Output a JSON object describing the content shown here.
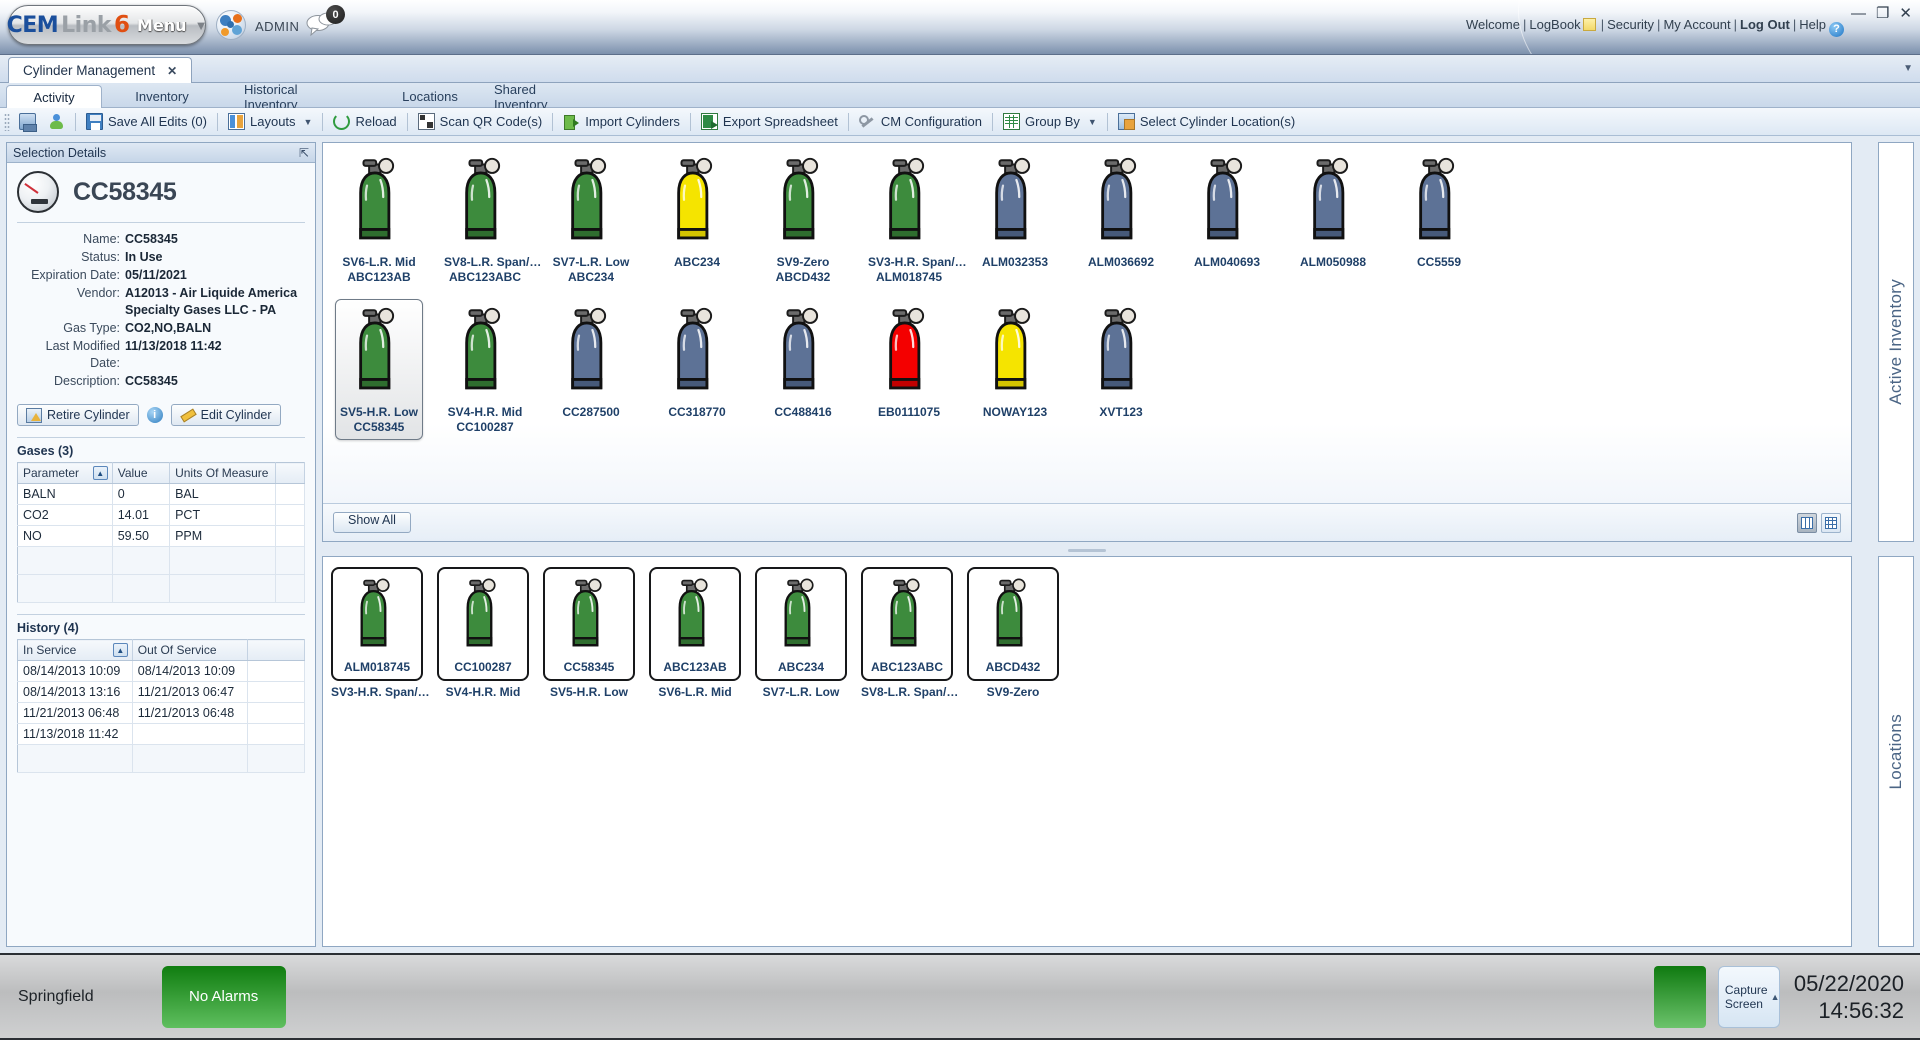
{
  "header": {
    "logo": {
      "cem": "CEM",
      "link": "Link",
      "six": "6",
      "menu": "Menu",
      "caret": "▼"
    },
    "globe_icon": "globe-icon",
    "user": "ADMIN",
    "chat_count": "0",
    "links": {
      "welcome": "Welcome",
      "logbook": "LogBook",
      "security": "Security",
      "my_account": "My Account",
      "log_out": "Log Out",
      "help": "Help",
      "help_glyph": "?",
      "sep": "|"
    },
    "window_controls": {
      "minimize": "—",
      "maximize": "❐",
      "close": "✕"
    }
  },
  "document_tab": {
    "title": "Cylinder Management",
    "close": "✕",
    "overflow_caret": "▼"
  },
  "subtabs": [
    {
      "label": "Activity",
      "active": true
    },
    {
      "label": "Inventory",
      "active": false
    },
    {
      "label": "Historical Inventory",
      "active": false
    },
    {
      "label": "Locations",
      "active": false
    },
    {
      "label": "Shared Inventory",
      "active": false
    }
  ],
  "toolbar": [
    {
      "label": "",
      "icon": "monitor-icon"
    },
    {
      "label": "",
      "icon": "user-icon"
    },
    {
      "label": "Save All Edits (0)",
      "icon": "save-icon"
    },
    {
      "label": "Layouts",
      "icon": "layouts-icon",
      "caret": "▼"
    },
    {
      "label": "Reload",
      "icon": "reload-icon"
    },
    {
      "label": "Scan QR Code(s)",
      "icon": "qr-icon"
    },
    {
      "label": "Import Cylinders",
      "icon": "import-icon"
    },
    {
      "label": "Export Spreadsheet",
      "icon": "export-icon"
    },
    {
      "label": "CM Configuration",
      "icon": "wrench-icon"
    },
    {
      "label": "Group By",
      "icon": "grid-icon",
      "caret": "▼"
    },
    {
      "label": "Select Cylinder Location(s)",
      "icon": "location-icon"
    }
  ],
  "selection_details": {
    "panel_title": "Selection Details",
    "pin_glyph": "⇱",
    "gauge_icon": "gauge-icon",
    "title": "CC58345",
    "fields": [
      {
        "key": "Name:",
        "value": "CC58345"
      },
      {
        "key": "Status:",
        "value": "In Use"
      },
      {
        "key": "Expiration Date:",
        "value": "05/11/2021"
      },
      {
        "key": "Vendor:",
        "value": "A12013 - Air Liquide America Specialty Gases LLC - PA"
      },
      {
        "key": "Gas Type:",
        "value": "CO2,NO,BALN"
      },
      {
        "key": "Last Modified Date:",
        "value": "11/13/2018 11:42"
      },
      {
        "key": "Description:",
        "value": "CC58345"
      }
    ],
    "retire_button": "Retire Cylinder",
    "info_glyph": "i",
    "edit_button": "Edit Cylinder",
    "gases": {
      "section_label": "Gases (3)",
      "columns": [
        "Parameter",
        "Value",
        "Units Of Measure",
        ""
      ],
      "sort_glyph": "▲",
      "rows": [
        [
          "BALN",
          "0",
          "BAL",
          ""
        ],
        [
          "CO2",
          "14.01",
          "PCT",
          ""
        ],
        [
          "NO",
          "59.50",
          "PPM",
          ""
        ]
      ]
    },
    "history": {
      "section_label": "History (4)",
      "columns": [
        "In Service",
        "Out Of Service",
        ""
      ],
      "sort_glyph": "▲",
      "rows": [
        [
          "08/14/2013 10:09",
          "08/14/2013 10:09",
          ""
        ],
        [
          "08/14/2013 13:16",
          "11/21/2013 06:47",
          ""
        ],
        [
          "11/21/2013 06:48",
          "11/21/2013 06:48",
          ""
        ],
        [
          "11/13/2018 11:42",
          "",
          ""
        ]
      ]
    }
  },
  "inventory_panel": {
    "show_all_button": "Show All",
    "view_toggles": [
      {
        "name": "column-view-toggle",
        "active": true
      },
      {
        "name": "grid-view-toggle",
        "active": false
      }
    ],
    "cylinders": [
      {
        "line1": "SV6-L.R. Mid",
        "line2": "ABC123AB",
        "color": "green",
        "selected": false
      },
      {
        "line1": "SV8-L.R. Span/…",
        "line2": "ABC123ABC",
        "color": "green",
        "selected": false
      },
      {
        "line1": "SV7-L.R. Low",
        "line2": "ABC234",
        "color": "green",
        "selected": false
      },
      {
        "line1": "ABC234",
        "line2": "",
        "color": "yellow",
        "selected": false
      },
      {
        "line1": "SV9-Zero",
        "line2": "ABCD432",
        "color": "green",
        "selected": false
      },
      {
        "line1": "SV3-H.R. Span/…",
        "line2": "ALM018745",
        "color": "green",
        "selected": false
      },
      {
        "line1": "ALM032353",
        "line2": "",
        "color": "blue",
        "selected": false
      },
      {
        "line1": "ALM036692",
        "line2": "",
        "color": "blue",
        "selected": false
      },
      {
        "line1": "ALM040693",
        "line2": "",
        "color": "blue",
        "selected": false
      },
      {
        "line1": "ALM050988",
        "line2": "",
        "color": "blue",
        "selected": false
      },
      {
        "line1": "CC5559",
        "line2": "",
        "color": "blue",
        "selected": false
      },
      {
        "line1": "SV5-H.R. Low",
        "line2": "CC58345",
        "color": "green",
        "selected": true
      },
      {
        "line1": "SV4-H.R. Mid",
        "line2": "CC100287",
        "color": "green",
        "selected": false
      },
      {
        "line1": "CC287500",
        "line2": "",
        "color": "blue",
        "selected": false
      },
      {
        "line1": "CC318770",
        "line2": "",
        "color": "blue",
        "selected": false
      },
      {
        "line1": "CC488416",
        "line2": "",
        "color": "blue",
        "selected": false
      },
      {
        "line1": "EB0111075",
        "line2": "",
        "color": "red",
        "selected": false
      },
      {
        "line1": "NOWAY123",
        "line2": "",
        "color": "yellow",
        "selected": false
      },
      {
        "line1": "XVT123",
        "line2": "",
        "color": "blue",
        "selected": false
      }
    ]
  },
  "locations_panel": {
    "cards": [
      {
        "inner_label": "ALM018745",
        "outer_label": "SV3-H.R. Span/…",
        "color": "green"
      },
      {
        "inner_label": "CC100287",
        "outer_label": "SV4-H.R. Mid",
        "color": "green"
      },
      {
        "inner_label": "CC58345",
        "outer_label": "SV5-H.R. Low",
        "color": "green"
      },
      {
        "inner_label": "ABC123AB",
        "outer_label": "SV6-L.R. Mid",
        "color": "green"
      },
      {
        "inner_label": "ABC234",
        "outer_label": "SV7-L.R. Low",
        "color": "green"
      },
      {
        "inner_label": "ABC123ABC",
        "outer_label": "SV8-L.R. Span/…",
        "color": "green"
      },
      {
        "inner_label": "ABCD432",
        "outer_label": "SV9-Zero",
        "color": "green"
      }
    ]
  },
  "vertical_tabs": [
    {
      "label": "Active Inventory"
    },
    {
      "label": "Locations"
    }
  ],
  "status_bar": {
    "location": "Springfield",
    "alarm_label": "No Alarms",
    "capture_line1": "Capture",
    "capture_line2": "Screen",
    "capture_caret": "▲",
    "date": "05/22/2020",
    "time": "14:56:32"
  },
  "colors": {
    "cylinder_green": "#3d8b3d",
    "cylinder_blue": "#5d7296",
    "cylinder_yellow": "#f5e400",
    "cylinder_red": "#f40000",
    "alarm_green": "#107d10",
    "accent_blue": "#1f4068"
  }
}
